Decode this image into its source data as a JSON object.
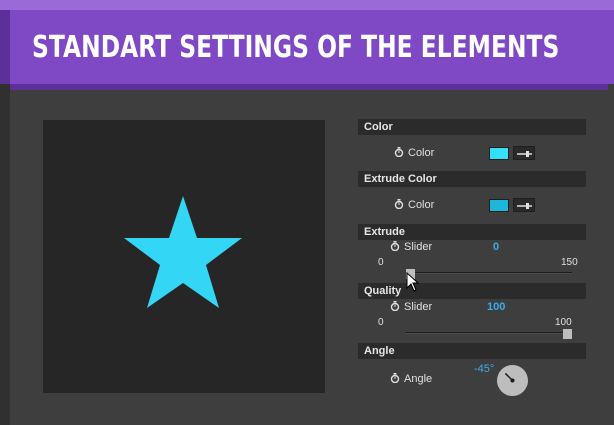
{
  "header": {
    "title": "Standart settings of the elements"
  },
  "viewport": {
    "shape": "star",
    "fill_color": "#33d6f5",
    "background": "#262626"
  },
  "panel": {
    "color": {
      "header": "Color",
      "label": "Color",
      "swatch_color": "#33e0f5"
    },
    "extrude_color": {
      "header": "Extrude Color",
      "label": "Color",
      "swatch_color": "#1fb6dc"
    },
    "extrude": {
      "header": "Extrude",
      "label": "Slider",
      "value": "0",
      "min": "0",
      "max": "150",
      "fraction": 0
    },
    "quality": {
      "header": "Quality",
      "label": "Slider",
      "value": "100",
      "min": "0",
      "max": "100",
      "fraction": 1
    },
    "angle": {
      "header": "Angle",
      "label": "Angle",
      "value": "-45°",
      "degrees": -45
    }
  },
  "icons": {
    "stopwatch": "stopwatch-icon",
    "eyedropper": "eyedropper-icon",
    "cursor": "mouse-cursor-icon"
  },
  "colors": {
    "banner": "#7f48c4",
    "accent_blue": "#38aee8"
  }
}
